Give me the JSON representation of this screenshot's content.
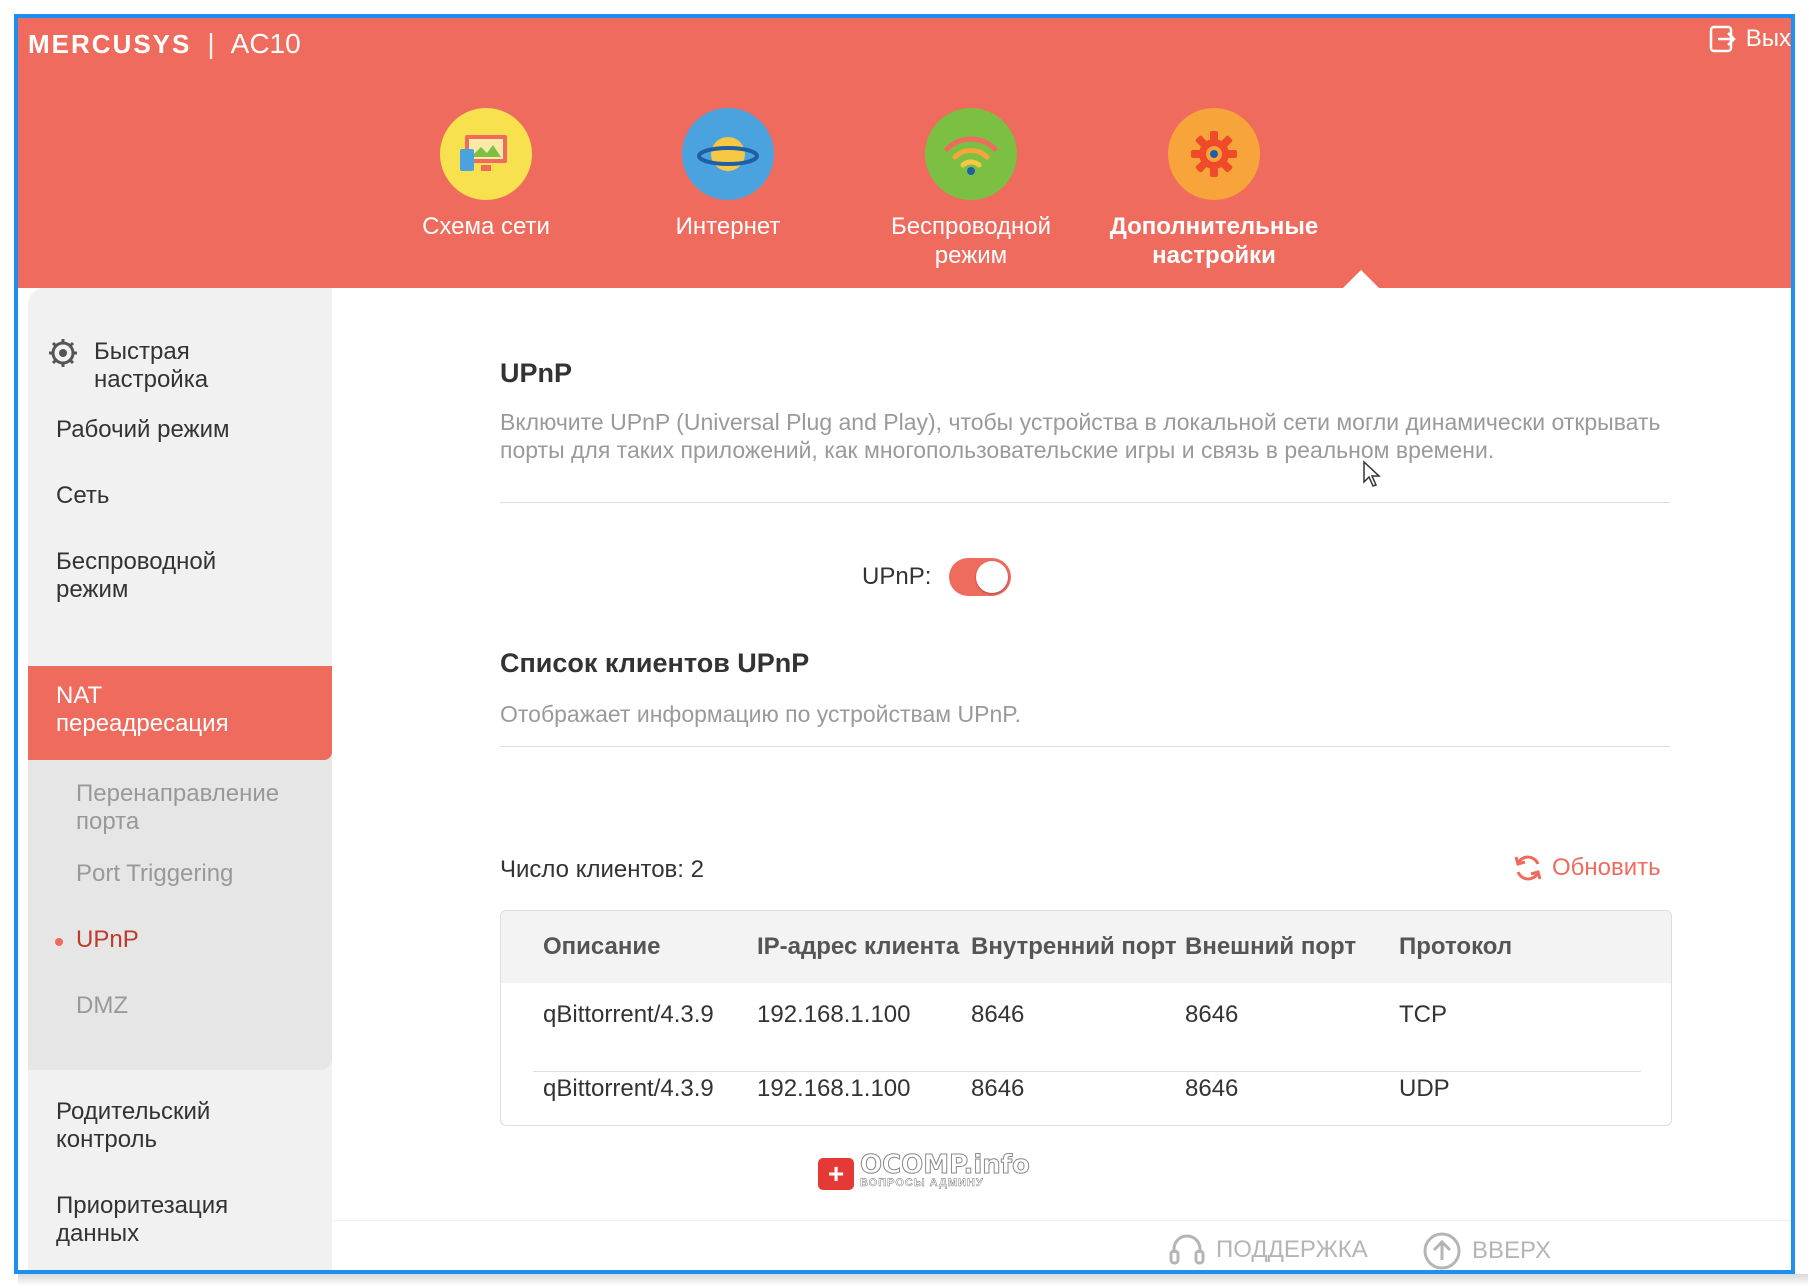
{
  "app": {
    "brand": "MERCUSYS",
    "model": "AC10",
    "logout_label": "Вых"
  },
  "nav": [
    {
      "label": "Схема сети",
      "icon": "network-map-icon",
      "active": false
    },
    {
      "label": "Интернет",
      "icon": "planet-icon",
      "active": false
    },
    {
      "label": "Беспроводной режим",
      "icon": "wifi-icon",
      "active": false
    },
    {
      "label": "Дополнительные настройки",
      "icon": "gear-icon",
      "active": true
    }
  ],
  "sidebar": {
    "items": [
      {
        "label": "Быстрая настройка",
        "icon": "gear-icon"
      },
      {
        "label": "Рабочий режим"
      },
      {
        "label": "Сеть"
      },
      {
        "label": "Беспроводной режим"
      },
      {
        "label": "NAT переадресация",
        "active": true
      },
      {
        "label": "Родительский контроль"
      },
      {
        "label": "Приоритезация данных"
      }
    ],
    "subitems": [
      {
        "label": "Перенаправление порта"
      },
      {
        "label": "Port Triggering"
      },
      {
        "label": "UPnP",
        "current": true
      },
      {
        "label": "DMZ"
      }
    ]
  },
  "upnp": {
    "title": "UPnP",
    "description": "Включите UPnP (Universal Plug and Play), чтобы устройства в локальной сети могли динамически открывать порты для таких приложений, как многопользовательские игры и связь в реальном времени.",
    "toggle_label": "UPnP:",
    "enabled": true
  },
  "clients": {
    "title": "Список клиентов UPnP",
    "description": "Отображает информацию по устройствам UPnP.",
    "count_label": "Число клиентов: 2",
    "refresh_label": "Обновить",
    "columns": [
      "Описание",
      "IP-адрес клиента",
      "Внутренний порт",
      "Внешний порт",
      "Протокол"
    ],
    "rows": [
      [
        "qBittorrent/4.3.9",
        "192.168.1.100",
        "8646",
        "8646",
        "TCP"
      ],
      [
        "qBittorrent/4.3.9",
        "192.168.1.100",
        "8646",
        "8646",
        "UDP"
      ]
    ]
  },
  "footer": {
    "support_label": "ПОДДЕРЖКА",
    "top_label": "ВВЕРХ"
  },
  "watermark": {
    "main": "OCOMP.info",
    "sub": "ВОПРОСЫ АДМИНУ"
  },
  "colors": {
    "accent": "#ef6b5d",
    "border": "#1f8ef1"
  }
}
